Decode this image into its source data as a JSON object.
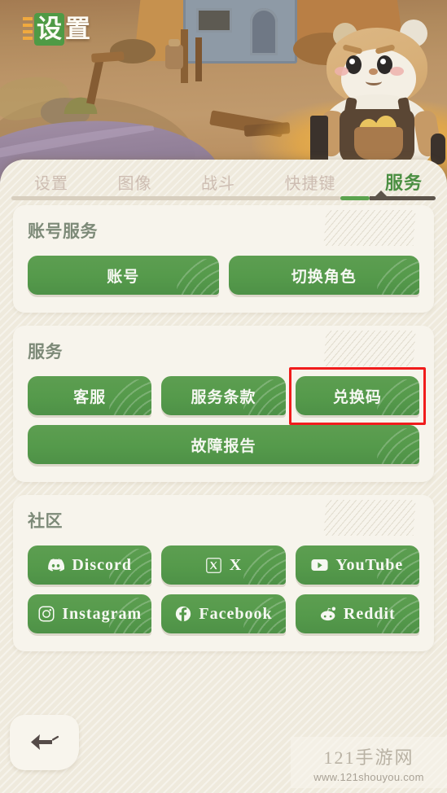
{
  "header": {
    "title_char_1": "设",
    "title_char_2": "置"
  },
  "tabs": [
    {
      "label": "设置",
      "active": false
    },
    {
      "label": "图像",
      "active": false
    },
    {
      "label": "战斗",
      "active": false
    },
    {
      "label": "快捷键",
      "active": false
    },
    {
      "label": "服务",
      "active": true
    }
  ],
  "cards": [
    {
      "title": "账号服务",
      "rows": [
        [
          {
            "label": "账号",
            "highlighted": false
          },
          {
            "label": "切换角色",
            "highlighted": false
          }
        ]
      ]
    },
    {
      "title": "服务",
      "rows": [
        [
          {
            "label": "客服",
            "highlighted": false
          },
          {
            "label": "服务条款",
            "highlighted": false
          },
          {
            "label": "兑换码",
            "highlighted": true
          }
        ],
        [
          {
            "label": "故障报告",
            "highlighted": false
          }
        ]
      ]
    },
    {
      "title": "社区",
      "rows": [
        [
          {
            "label": "Discord",
            "icon": "discord-icon"
          },
          {
            "label": "X",
            "icon": "x-twitter-icon"
          },
          {
            "label": "YouTube",
            "icon": "youtube-icon"
          }
        ],
        [
          {
            "label": "Instagram",
            "icon": "instagram-icon"
          },
          {
            "label": "Facebook",
            "icon": "facebook-icon"
          },
          {
            "label": "Reddit",
            "icon": "reddit-icon"
          }
        ]
      ]
    }
  ],
  "back_button": {
    "icon": "back-arrow-icon"
  },
  "watermark": {
    "site_name": "121手游网",
    "url": "www.121shouyou.com"
  },
  "colors": {
    "accent_green": "#559a4b",
    "highlight_red": "#f01c1c",
    "card_bg": "#f7f4ec",
    "panel_bg": "#efeadd",
    "heading": "#7d8a78"
  }
}
